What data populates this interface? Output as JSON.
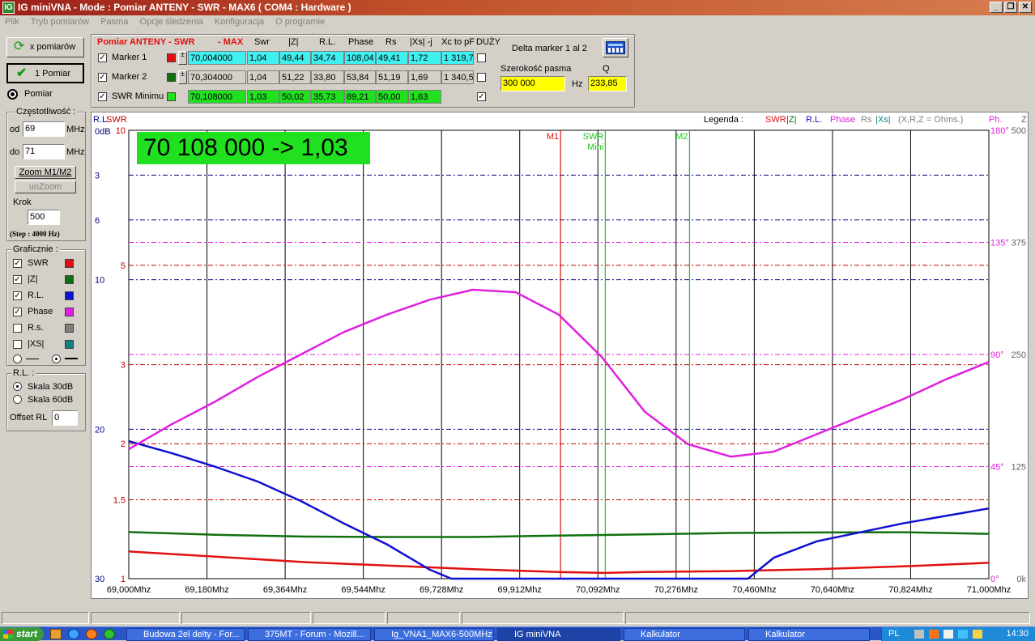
{
  "window": {
    "title": "IG miniVNA - Mode : Pomiar ANTENY - SWR    - MAX6 ( COM4 : Hardware )",
    "controls": [
      "_",
      "❐",
      "✕"
    ]
  },
  "menu": [
    "Plik",
    "Tryb pomiarów",
    "Pasma",
    "Opcje śledzenia",
    "Konfiguracja",
    "O programie"
  ],
  "left": {
    "x_pomiarow": "x pomiarów",
    "one_pomiar": "1 Pomiar",
    "pomiar": "Pomiar",
    "czestotliwosc": "Częstotliwość :",
    "od_label": "od",
    "od_value": "69",
    "do_label": "do",
    "do_value": "71",
    "mhz": "MHz",
    "zoom": "Zoom M1/M2",
    "unzoom": "unZoom",
    "krok_label": "Krok",
    "krok_value": "500",
    "step": "(Step : 4000 Hz)",
    "graficznie": "Graficznie :",
    "traces": [
      {
        "label": "SWR",
        "checked": "✓",
        "color": "#e01010"
      },
      {
        "label": "|Z|",
        "checked": "✓",
        "color": "#107010"
      },
      {
        "label": "R.L.",
        "checked": "✓",
        "color": "#1010d0"
      },
      {
        "label": "Phase",
        "checked": "✓",
        "color": "#e020e0"
      },
      {
        "label": "R.s.",
        "checked": "",
        "color": "#808080"
      },
      {
        "label": "|XS|",
        "checked": "",
        "color": "#108080"
      }
    ],
    "rl_group": "R.L. :",
    "skala30": "Skala 30dB",
    "skala60": "Skala 60dB",
    "offset_label": "Offset RL",
    "offset_value": "0"
  },
  "table": {
    "title": "Pomiar ANTENY - SWR",
    "max": "- MAX",
    "headers": [
      "Swr",
      "|Z|",
      "R.L.",
      "Phase",
      "Rs",
      "|Xs| -j",
      "Xc to pF",
      "DUŻY"
    ],
    "rows": [
      {
        "name": "Marker 1",
        "checked": "✓",
        "color": "#e01010",
        "freq": "70,004000",
        "vals": [
          "1,04",
          "49,44",
          "34,74",
          "108,04",
          "49,41",
          "1,72",
          "1 319,7"
        ],
        "bg": "#40f0f0",
        "dchk": ""
      },
      {
        "name": "Marker 2",
        "checked": "✓",
        "color": "#107010",
        "freq": "70,304000",
        "vals": [
          "1,04",
          "51,22",
          "33,80",
          "53,84",
          "51,19",
          "1,69",
          "1 340,5"
        ],
        "bg": "#d4d0c8",
        "dchk": ""
      },
      {
        "name": "SWR Minimu",
        "checked": "✓",
        "color": "#20e020",
        "freq": "70,108000",
        "vals": [
          "1,03",
          "50,02",
          "35,73",
          "89,21",
          "50,00",
          "1,63"
        ],
        "bg": "#20e020",
        "dchk": "✓"
      }
    ],
    "delta": "Delta marker 1 al 2",
    "szerokosc": "Szerokość pasma",
    "q_label": "Q",
    "bw_value": "300 000",
    "hz": "Hz",
    "q_value": "233,85"
  },
  "chart_data": {
    "type": "line",
    "readout": "70 108 000 -> 1,03",
    "legend_title": "Legenda :",
    "legend": [
      {
        "name": "SWR",
        "color": "#e01010"
      },
      {
        "name": "|Z|",
        "color": "#107010"
      },
      {
        "name": "R.L.",
        "color": "#1010d0"
      },
      {
        "name": "Phase",
        "color": "#e020e0"
      },
      {
        "name": "Rs",
        "color": "#808080"
      },
      {
        "name": "|Xs|",
        "color": "#108080"
      },
      {
        "name": "(X,R,Z = Ohms.)",
        "color": "#808080"
      }
    ],
    "left_top_labels": {
      "rl": "R.L.",
      "swr": "SWR",
      "db": "0dB",
      "ph": "Ph.",
      "z": "Z"
    },
    "x_ticks": [
      "69,000Mhz",
      "69,180Mhz",
      "69,364Mhz",
      "69,544Mhz",
      "69,728Mhz",
      "69,912Mhz",
      "70,092Mhz",
      "70,276Mhz",
      "70,460Mhz",
      "70,640Mhz",
      "70,824Mhz",
      "71,000Mhz"
    ],
    "x_range": [
      69.0,
      71.0
    ],
    "swr_ticks": [
      {
        "label": "10",
        "v": 10
      },
      {
        "label": "5",
        "v": 5
      },
      {
        "label": "3",
        "v": 3
      },
      {
        "label": "2",
        "v": 2
      },
      {
        "label": "1.5",
        "v": 1.5
      },
      {
        "label": "1",
        "v": 1
      }
    ],
    "rl_ticks": [
      {
        "label": "3",
        "v": 3
      },
      {
        "label": "6",
        "v": 6
      },
      {
        "label": "10",
        "v": 10
      },
      {
        "label": "20",
        "v": 20
      },
      {
        "label": "30",
        "v": 30
      }
    ],
    "phase_ticks": [
      {
        "label": "180°",
        "v": 180
      },
      {
        "label": "135°",
        "v": 135
      },
      {
        "label": "90°",
        "v": 90
      },
      {
        "label": "45°",
        "v": 45
      },
      {
        "label": "0°",
        "v": 0
      }
    ],
    "z_ticks": [
      {
        "label": "500",
        "v": 500
      },
      {
        "label": "375",
        "v": 375
      },
      {
        "label": "250",
        "v": 250
      },
      {
        "label": "125",
        "v": 125
      },
      {
        "label": "0k",
        "v": 0
      }
    ],
    "markers": [
      {
        "label": "M1",
        "f": 70.004,
        "color": "#e01010"
      },
      {
        "label": "SWR",
        "label2": "Mini",
        "f": 70.108,
        "color": "#20c020"
      },
      {
        "label": "M2",
        "f": 70.304,
        "color": "#20c020"
      }
    ],
    "series": [
      {
        "name": "SWR",
        "unit": "swr",
        "color": "#e01010",
        "x": [
          69.0,
          69.2,
          69.4,
          69.6,
          69.8,
          70.0,
          70.108,
          70.2,
          70.4,
          70.6,
          70.8,
          71.0
        ],
        "y": [
          1.15,
          1.12,
          1.09,
          1.07,
          1.05,
          1.035,
          1.03,
          1.035,
          1.04,
          1.05,
          1.065,
          1.085
        ]
      },
      {
        "name": "|Z|",
        "unit": "ohm",
        "color": "#107010",
        "x": [
          69.0,
          69.2,
          69.4,
          69.6,
          69.8,
          70.0,
          70.2,
          70.4,
          70.6,
          70.8,
          71.0
        ],
        "y": [
          52,
          49,
          47,
          46.5,
          46.5,
          48,
          49.5,
          51,
          51.5,
          51.8,
          50
        ]
      },
      {
        "name": "R.L.",
        "unit": "db",
        "color": "#1010d0",
        "x": [
          69.0,
          69.1,
          69.2,
          69.3,
          69.4,
          69.5,
          69.6,
          69.7,
          69.75,
          69.8,
          70.0,
          70.2,
          70.4,
          70.44,
          70.5,
          70.6,
          70.7,
          70.8,
          70.9,
          71.0
        ],
        "y": [
          20.8,
          21.6,
          22.5,
          23.5,
          24.8,
          26.3,
          27.7,
          29.4,
          30,
          31,
          34,
          35.7,
          32,
          30,
          28.6,
          27.5,
          26.9,
          26.3,
          25.8,
          25.3
        ]
      },
      {
        "name": "Phase",
        "unit": "deg",
        "color": "#e020e0",
        "x": [
          69.0,
          69.1,
          69.2,
          69.3,
          69.4,
          69.5,
          69.6,
          69.7,
          69.8,
          69.9,
          70.0,
          70.1,
          70.2,
          70.3,
          70.4,
          70.5,
          70.6,
          70.7,
          70.8,
          70.9,
          71.0
        ],
        "y": [
          52,
          62,
          71,
          81,
          90,
          99,
          106,
          112,
          116,
          115,
          106,
          89,
          67,
          54,
          49,
          51,
          58,
          65,
          72,
          80,
          87
        ]
      }
    ]
  },
  "status": [
    "",
    "",
    "",
    "",
    "",
    "",
    ""
  ],
  "taskbar": {
    "start": "start",
    "tasks": [
      "Budowa 2el delty - For...",
      "375MT - Forum - Mozill...",
      "Ig_VNA1_MAX6-500MHz",
      "IG miniVNA",
      "Kalkulator",
      "Kalkulator"
    ],
    "lang": "PL",
    "time": "14:30"
  }
}
